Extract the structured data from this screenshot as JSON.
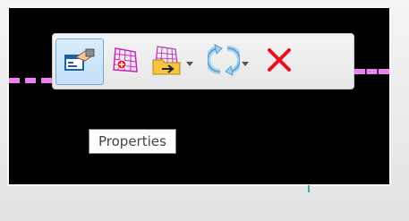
{
  "toolbar": {
    "buttons": [
      {
        "icon": "properties-icon",
        "active": true
      },
      {
        "icon": "mesh-point-icon",
        "active": false
      },
      {
        "icon": "mesh-export-icon",
        "active": false,
        "has_dropdown": true
      },
      {
        "icon": "rotate-icon",
        "active": false,
        "has_dropdown": true
      },
      {
        "icon": "close-icon",
        "active": false
      }
    ]
  },
  "tooltip": {
    "text": "Properties"
  },
  "colors": {
    "canvas": "#000000",
    "dashed_line": "#f080f0",
    "toolbar_bg": "#eeeeee",
    "active_button": "#c4e0f7",
    "close_red": "#e81123"
  }
}
